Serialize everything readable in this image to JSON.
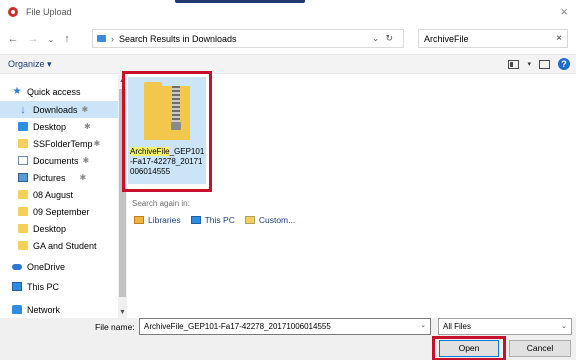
{
  "window": {
    "title": "File Upload"
  },
  "address": {
    "path": [
      "Search Results in Downloads"
    ]
  },
  "search": {
    "value": "ArchiveFile"
  },
  "toolbar": {
    "organize": "Organize ▾"
  },
  "nav": {
    "items": [
      {
        "label": "Quick access",
        "icon": "star-icon"
      },
      {
        "label": "Downloads",
        "icon": "download-icon",
        "selected": true,
        "pinned": true
      },
      {
        "label": "Desktop",
        "icon": "desktop-icon",
        "pinned": true
      },
      {
        "label": "SSFolderTemp",
        "icon": "folder-icon",
        "pinned": true
      },
      {
        "label": "Documents",
        "icon": "documents-icon",
        "pinned": true
      },
      {
        "label": "Pictures",
        "icon": "pictures-icon",
        "pinned": true
      },
      {
        "label": "08 August",
        "icon": "folder-icon"
      },
      {
        "label": "09 September",
        "icon": "folder-icon"
      },
      {
        "label": "Desktop",
        "icon": "folder-icon"
      },
      {
        "label": "GA and Student",
        "icon": "folder-icon"
      },
      {
        "label": "OneDrive",
        "icon": "onedrive-icon"
      },
      {
        "label": "This PC",
        "icon": "this-pc-icon"
      },
      {
        "label": "Network",
        "icon": "network-icon"
      }
    ]
  },
  "results": {
    "files": [
      {
        "name_highlight": "ArchiveFile",
        "name_rest": "_GEP101-Fa17-42278_20171006014555",
        "icon": "zip-folder-icon"
      }
    ],
    "search_again": "Search again in:",
    "search_links": [
      {
        "label": "Libraries",
        "icon": "libraries-icon"
      },
      {
        "label": "This PC",
        "icon": "this-pc-icon"
      },
      {
        "label": "Custom...",
        "icon": "custom-icon"
      }
    ]
  },
  "footer": {
    "file_name_label": "File name:",
    "file_name_value": "ArchiveFile_GEP101-Fa17-42278_20171006014555",
    "file_type": "All Files",
    "open_label": "Open",
    "cancel_label": "Cancel"
  },
  "colors": {
    "selection": "#cce4f7",
    "highlight_box": "#c8102e",
    "accent": "#0078d7"
  }
}
